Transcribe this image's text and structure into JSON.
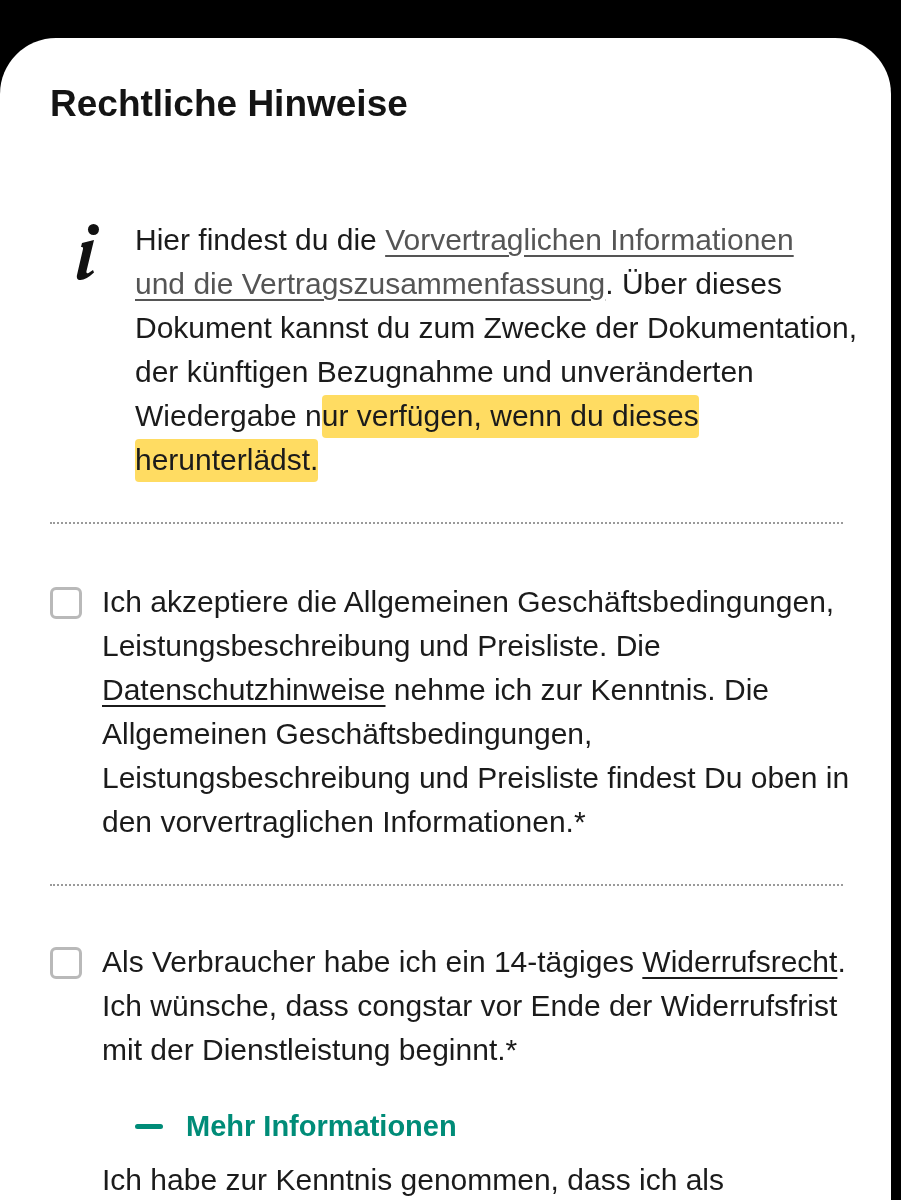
{
  "title": "Rechtliche Hinweise",
  "info": {
    "segments": [
      {
        "kind": "text",
        "text": "Hier findest du die "
      },
      {
        "kind": "link",
        "lines": [
          "Vorvertraglichen Informationen",
          "und die Vertragszusammenfassung"
        ]
      },
      {
        "kind": "text",
        "text": ". Über dieses Dokument kannst du zum Zwecke der Dokumentation, der künftigen Bezugnahme und unveränderten Wiedergabe n"
      },
      {
        "kind": "highlight",
        "text": "ur verfügen, wenn du dieses herunterlädst."
      }
    ]
  },
  "consents": [
    {
      "checked": false,
      "segments": [
        {
          "kind": "text",
          "text": "Ich akzeptiere die Allgemeinen Geschäftsbedingungen, Leistungsbeschreibung und Preisliste. Die "
        },
        {
          "kind": "link",
          "lines": [
            "Datenschutzhinweise"
          ]
        },
        {
          "kind": "text",
          "text": " nehme ich zur Kenntnis. Die Allgemeinen Geschäftsbedingungen, Leistungsbeschreibung und Preisliste findest Du oben in den vorvertraglichen Informationen.*"
        }
      ]
    },
    {
      "checked": false,
      "segments": [
        {
          "kind": "text",
          "text": "Als Verbraucher habe ich ein 14-tägiges "
        },
        {
          "kind": "link",
          "lines": [
            "Widerrufsrecht"
          ]
        },
        {
          "kind": "text",
          "text": ". Ich wünsche, dass congstar vor Ende der Widerrufsfrist mit der Dienstleistung beginnt.*"
        }
      ]
    }
  ],
  "more_info": {
    "label": "Mehr Informationen",
    "expanded": true,
    "text": "Ich habe zur Kenntnis genommen, dass ich als"
  }
}
